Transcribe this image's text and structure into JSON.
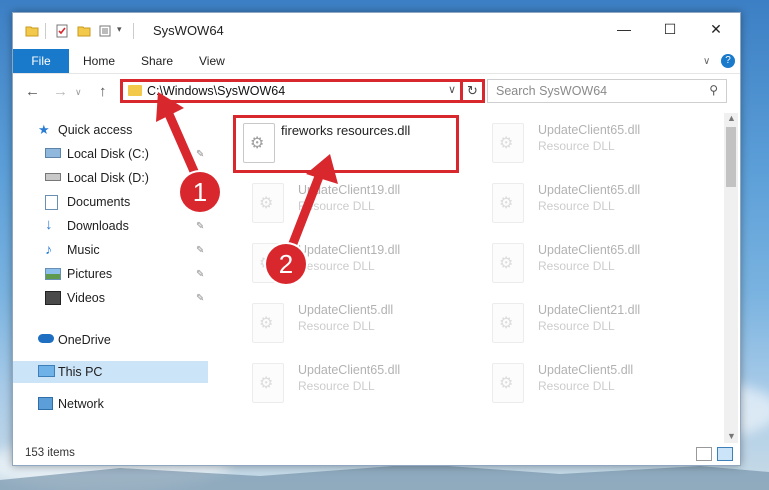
{
  "window": {
    "title": "SysWOW64",
    "controls": {
      "minimize": "—",
      "maximize": "☐",
      "close": "✕"
    }
  },
  "ribbon": {
    "tabs": [
      "File",
      "Home",
      "Share",
      "View"
    ],
    "collapse_glyph": "∨",
    "help_glyph": "?"
  },
  "nav": {
    "back": "←",
    "forward": "→",
    "up": "↑"
  },
  "address": {
    "path": "C:\\Windows\\SysWOW64",
    "dropdown_glyph": "∨",
    "refresh_glyph": "↻"
  },
  "search": {
    "placeholder": "Search SysWOW64",
    "icon": "search-icon"
  },
  "sidebar": {
    "items": [
      {
        "label": "Quick access",
        "icon": "star-icon"
      },
      {
        "label": "Local Disk (C:)",
        "icon": "drive-icon",
        "pinned": true
      },
      {
        "label": "Local Disk (D:)",
        "icon": "drive-icon",
        "pinned": false
      },
      {
        "label": "Documents",
        "icon": "documents-icon",
        "pinned": true
      },
      {
        "label": "Downloads",
        "icon": "downloads-icon",
        "pinned": true
      },
      {
        "label": "Music",
        "icon": "music-icon",
        "pinned": true
      },
      {
        "label": "Pictures",
        "icon": "pictures-icon",
        "pinned": true
      },
      {
        "label": "Videos",
        "icon": "videos-icon",
        "pinned": true
      },
      {
        "label": "OneDrive",
        "icon": "onedrive-icon"
      },
      {
        "label": "This PC",
        "icon": "pc-icon",
        "selected": true
      },
      {
        "label": "Network",
        "icon": "network-icon"
      }
    ],
    "pin_glyph": "✎"
  },
  "files": {
    "highlighted": {
      "name": "fireworks resources.dll"
    },
    "items": [
      {
        "name": "UpdateClient65.dll",
        "type": "Resource DLL"
      },
      {
        "name": "UpdateClient19.dll",
        "type": "Resource DLL"
      },
      {
        "name": "UpdateClient65.dll",
        "type": "Resource DLL"
      },
      {
        "name": "UpdateClient19.dll",
        "type": "Resource DLL"
      },
      {
        "name": "UpdateClient65.dll",
        "type": "Resource DLL"
      },
      {
        "name": "UpdateClient5.dll",
        "type": "Resource DLL"
      },
      {
        "name": "UpdateClient21.dll",
        "type": "Resource DLL"
      },
      {
        "name": "UpdateClient65.dll",
        "type": "Resource DLL"
      },
      {
        "name": "UpdateClient5.dll",
        "type": "Resource DLL"
      }
    ]
  },
  "status": {
    "count": "153 items"
  },
  "annotations": {
    "step1": "1",
    "step2": "2"
  },
  "colors": {
    "accent": "#1979ca",
    "highlight": "#d9272e",
    "selected": "#cce4f7"
  }
}
